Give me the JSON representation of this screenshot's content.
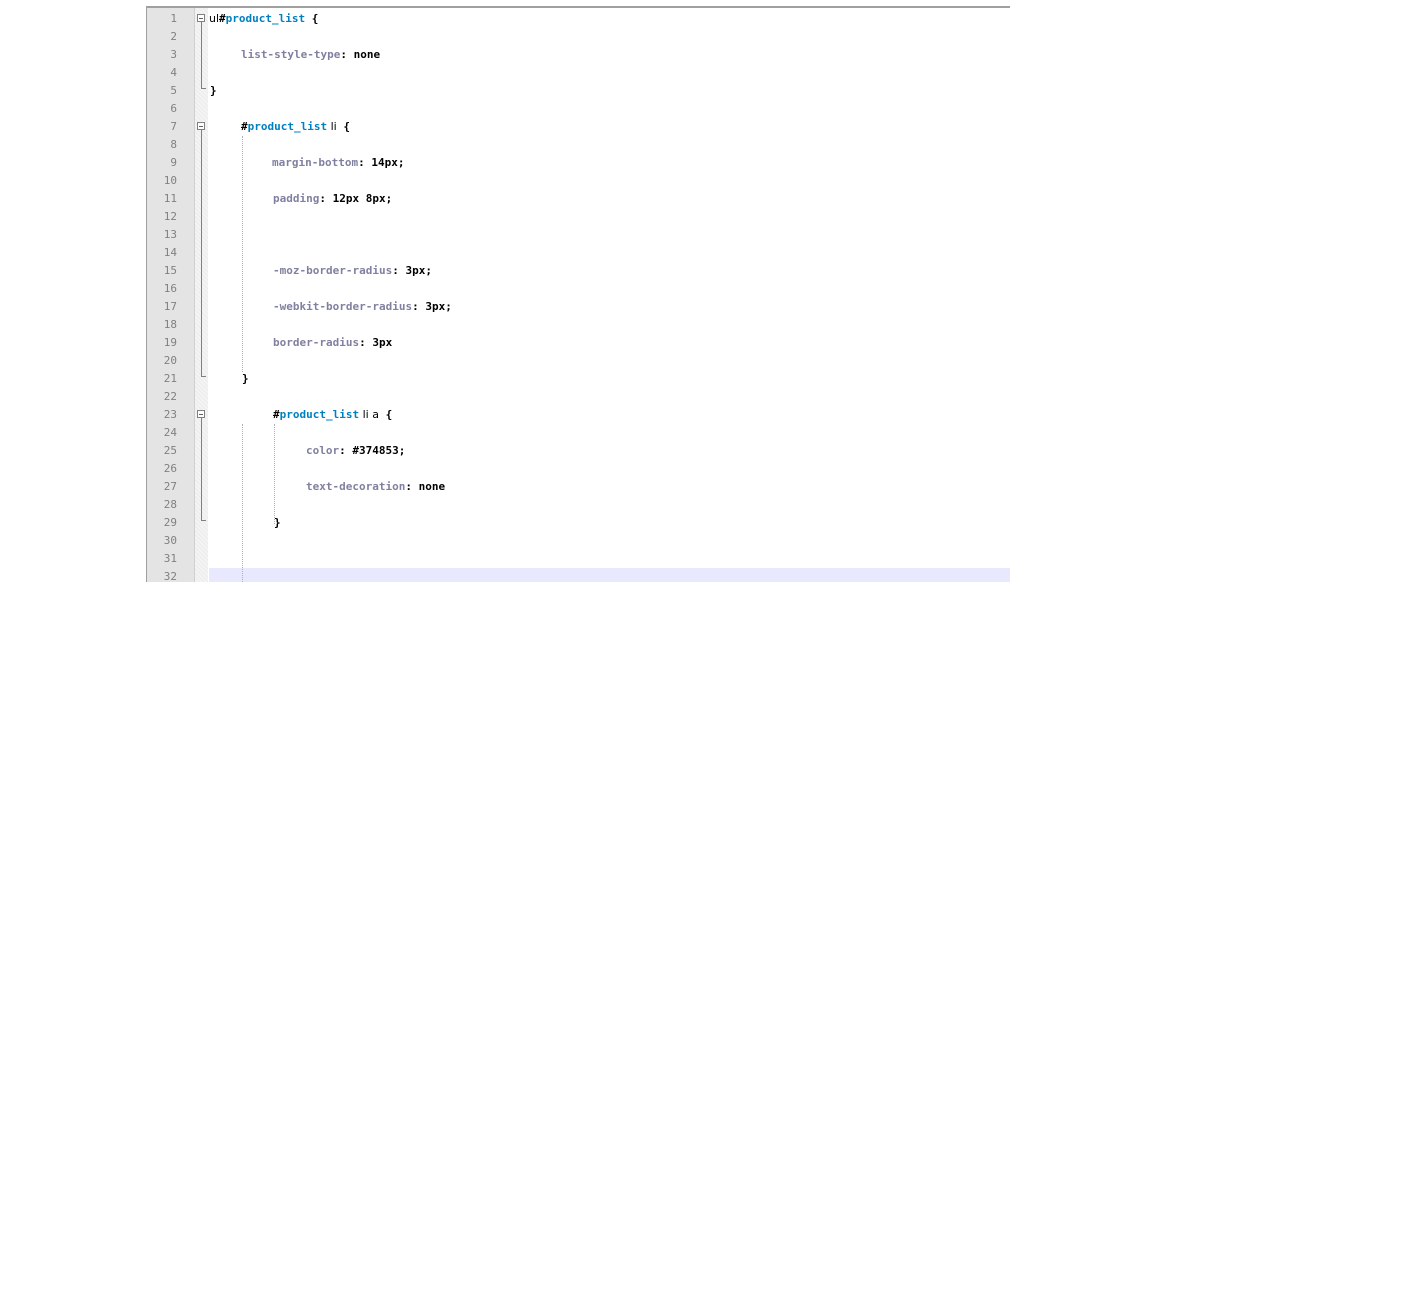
{
  "editor": {
    "line_numbers": [
      "1",
      "2",
      "3",
      "4",
      "5",
      "6",
      "7",
      "8",
      "9",
      "10",
      "11",
      "12",
      "13",
      "14",
      "15",
      "16",
      "17",
      "18",
      "19",
      "20",
      "21",
      "22",
      "23",
      "24",
      "25",
      "26",
      "27",
      "28",
      "29",
      "30",
      "31",
      "32"
    ],
    "code": {
      "l1": {
        "tag": "ul",
        "hash": "#",
        "selector": "product_list",
        "brace": " {"
      },
      "l3": {
        "prop": "list-style-type",
        "sep": ": ",
        "value": "none"
      },
      "l5": {
        "brace": "}"
      },
      "l7": {
        "hash": "#",
        "selector": "product_list",
        "tag": " li",
        "brace": " {"
      },
      "l9": {
        "prop": "margin-bottom",
        "sep": ": ",
        "value": "14px;"
      },
      "l11": {
        "prop": "padding",
        "sep": ": ",
        "value": "12px 8px;"
      },
      "l15": {
        "prop": "-moz-border-radius",
        "sep": ": ",
        "value": "3px;"
      },
      "l17": {
        "prop": "-webkit-border-radius",
        "sep": ": ",
        "value": "3px;"
      },
      "l19": {
        "prop": "border-radius",
        "sep": ": ",
        "value": "3px"
      },
      "l21": {
        "brace": "}"
      },
      "l23": {
        "hash": "#",
        "selector": "product_list",
        "tag": " li a",
        "brace": " {"
      },
      "l25": {
        "prop": "color",
        "sep": ": ",
        "value": "#374853;"
      },
      "l27": {
        "prop": "text-decoration",
        "sep": ": ",
        "value": "none"
      },
      "l29": {
        "brace": "}"
      }
    },
    "colors": {
      "selector": "#0080c0",
      "property": "#8080a0",
      "value": "#000000",
      "current_line": "#e8e8ff",
      "gutter": "#e4e4e4"
    }
  }
}
